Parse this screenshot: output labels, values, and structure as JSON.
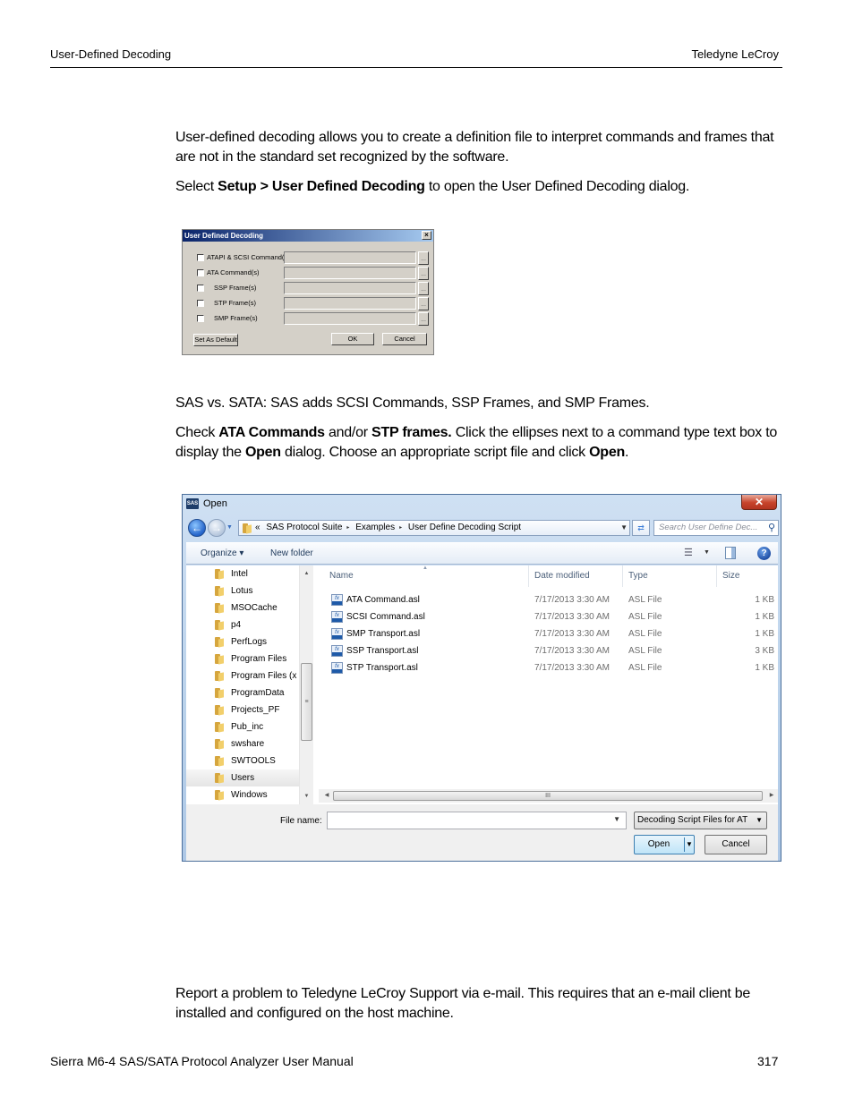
{
  "header": {
    "section_title": "User-Defined Decoding",
    "company": "Teledyne LeCroy"
  },
  "intro": {
    "paragraph1": "User-defined decoding allows you to create a definition file to interpret commands and frames that are not in the standard set recognized by the software.",
    "select_prefix": "Select ",
    "select_bold": "Setup > User Defined Decoding",
    "select_suffix": " to open the User Defined Decoding dialog."
  },
  "udd_dialog": {
    "title": "User Defined Decoding",
    "close_glyph": "×",
    "rows": [
      {
        "label": "ATAPI & SCSI Command(s)",
        "checked": false,
        "value": ""
      },
      {
        "label": "ATA Command(s)",
        "checked": false,
        "value": ""
      },
      {
        "label": "SSP Frame(s)",
        "checked": false,
        "value": ""
      },
      {
        "label": "STP Frame(s)",
        "checked": false,
        "value": ""
      },
      {
        "label": "SMP Frame(s)",
        "checked": false,
        "value": ""
      }
    ],
    "ellipsis": "...",
    "set_default_label": "Set As Default",
    "ok_label": "OK",
    "cancel_label": "Cancel"
  },
  "notes": {
    "sas_vs_sata": "SAS vs. SATA: SAS adds SCSI Commands, SSP Frames, and SMP Frames.",
    "check_prefix": "Check ",
    "check_bold1": "ATA Commands",
    "check_mid1": " and/or ",
    "check_bold2": "STP frames.",
    "check_mid2": " Click the ellipses next to a command type text box to display the ",
    "check_bold3": "Open",
    "check_mid3": " dialog. Choose an appropriate script file and click ",
    "check_bold4": "Open",
    "check_end": "."
  },
  "open_dialog": {
    "app_icon_text": "SAS",
    "title": "Open",
    "close_glyph": "✕",
    "breadcrumb": {
      "overflow": "«",
      "items": [
        "SAS Protocol Suite",
        "Examples",
        "User Define Decoding Script"
      ],
      "separator": "▸"
    },
    "search_placeholder": "Search User Define Dec...",
    "toolbar": {
      "organize_label": "Organize ▾",
      "new_folder_label": "New folder"
    },
    "tree": [
      {
        "name": "Intel",
        "selected": false
      },
      {
        "name": "Lotus",
        "selected": false
      },
      {
        "name": "MSOCache",
        "selected": false
      },
      {
        "name": "p4",
        "selected": false
      },
      {
        "name": "PerfLogs",
        "selected": false
      },
      {
        "name": "Program Files",
        "selected": false
      },
      {
        "name": "Program Files (x",
        "selected": false
      },
      {
        "name": "ProgramData",
        "selected": false
      },
      {
        "name": "Projects_PF",
        "selected": false
      },
      {
        "name": "Pub_inc",
        "selected": false
      },
      {
        "name": "swshare",
        "selected": false
      },
      {
        "name": "SWTOOLS",
        "selected": false
      },
      {
        "name": "Users",
        "selected": true
      },
      {
        "name": "Windows",
        "selected": false
      }
    ],
    "columns": {
      "name": "Name",
      "date": "Date modified",
      "type": "Type",
      "size": "Size"
    },
    "files": [
      {
        "name": "ATA Command.asl",
        "date": "7/17/2013 3:30 AM",
        "type": "ASL File",
        "size": "1 KB"
      },
      {
        "name": "SCSI Command.asl",
        "date": "7/17/2013 3:30 AM",
        "type": "ASL File",
        "size": "1 KB"
      },
      {
        "name": "SMP Transport.asl",
        "date": "7/17/2013 3:30 AM",
        "type": "ASL File",
        "size": "1 KB"
      },
      {
        "name": "SSP Transport.asl",
        "date": "7/17/2013 3:30 AM",
        "type": "ASL File",
        "size": "3 KB"
      },
      {
        "name": "STP Transport.asl",
        "date": "7/17/2013 3:30 AM",
        "type": "ASL File",
        "size": "1 KB"
      }
    ],
    "file_icon_text": "fx",
    "file_name_label": "File name:",
    "file_name_value": "",
    "filter_value": "Decoding Script Files for AT",
    "open_label": "Open",
    "cancel_label": "Cancel"
  },
  "report": {
    "paragraph": "Report a problem to Teledyne LeCroy Support via e-mail. This requires that an e-mail client be installed and configured on the host machine."
  },
  "footer": {
    "manual_title": "Sierra M6-4 SAS/SATA Protocol Analyzer User Manual",
    "page_number": "317"
  }
}
